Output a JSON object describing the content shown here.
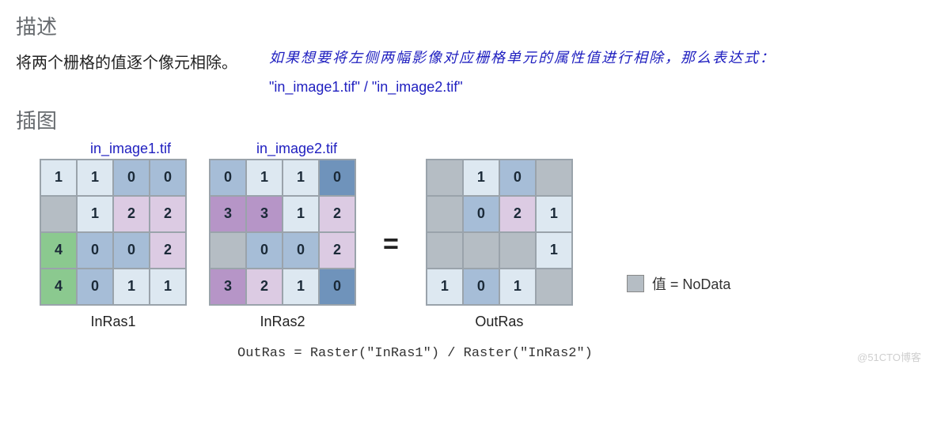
{
  "headings": {
    "describe": "描述",
    "illustration": "插图"
  },
  "description": "将两个栅格的值逐个像元相除。",
  "annotation": {
    "line": "如果想要将左侧两幅影像对应栅格单元的属性值进行相除，那么表达式：",
    "expr": "\"in_image1.tif\" / \"in_image2.tif\""
  },
  "image_labels": {
    "img1": "in_image1.tif",
    "img2": "in_image2.tif"
  },
  "grids": {
    "inras1": {
      "caption": "InRas1",
      "cells": [
        [
          {
            "v": "1",
            "c": "c-lb"
          },
          {
            "v": "1",
            "c": "c-lb"
          },
          {
            "v": "0",
            "c": "c-mb"
          },
          {
            "v": "0",
            "c": "c-mb"
          }
        ],
        [
          {
            "v": "",
            "c": "c-nd"
          },
          {
            "v": "1",
            "c": "c-lb"
          },
          {
            "v": "2",
            "c": "c-lp"
          },
          {
            "v": "2",
            "c": "c-lp"
          }
        ],
        [
          {
            "v": "4",
            "c": "c-gr"
          },
          {
            "v": "0",
            "c": "c-mb"
          },
          {
            "v": "0",
            "c": "c-mb"
          },
          {
            "v": "2",
            "c": "c-lp"
          }
        ],
        [
          {
            "v": "4",
            "c": "c-gr"
          },
          {
            "v": "0",
            "c": "c-mb"
          },
          {
            "v": "1",
            "c": "c-lb"
          },
          {
            "v": "1",
            "c": "c-lb"
          }
        ]
      ]
    },
    "inras2": {
      "caption": "InRas2",
      "cells": [
        [
          {
            "v": "0",
            "c": "c-mb"
          },
          {
            "v": "1",
            "c": "c-lb"
          },
          {
            "v": "1",
            "c": "c-lb"
          },
          {
            "v": "0",
            "c": "c-db"
          }
        ],
        [
          {
            "v": "3",
            "c": "c-mp"
          },
          {
            "v": "3",
            "c": "c-mp"
          },
          {
            "v": "1",
            "c": "c-lb"
          },
          {
            "v": "2",
            "c": "c-lp"
          }
        ],
        [
          {
            "v": "",
            "c": "c-nd"
          },
          {
            "v": "0",
            "c": "c-mb"
          },
          {
            "v": "0",
            "c": "c-mb"
          },
          {
            "v": "2",
            "c": "c-lp"
          }
        ],
        [
          {
            "v": "3",
            "c": "c-mp"
          },
          {
            "v": "2",
            "c": "c-lp"
          },
          {
            "v": "1",
            "c": "c-lb"
          },
          {
            "v": "0",
            "c": "c-db"
          }
        ]
      ]
    },
    "outras": {
      "caption": "OutRas",
      "cells": [
        [
          {
            "v": "",
            "c": "c-nd"
          },
          {
            "v": "1",
            "c": "c-lb"
          },
          {
            "v": "0",
            "c": "c-mb"
          },
          {
            "v": "",
            "c": "c-nd"
          }
        ],
        [
          {
            "v": "",
            "c": "c-nd"
          },
          {
            "v": "0",
            "c": "c-mb"
          },
          {
            "v": "2",
            "c": "c-lp"
          },
          {
            "v": "1",
            "c": "c-lb"
          }
        ],
        [
          {
            "v": "",
            "c": "c-nd"
          },
          {
            "v": "",
            "c": "c-nd"
          },
          {
            "v": "",
            "c": "c-nd"
          },
          {
            "v": "1",
            "c": "c-lb"
          }
        ],
        [
          {
            "v": "1",
            "c": "c-lb"
          },
          {
            "v": "0",
            "c": "c-mb"
          },
          {
            "v": "1",
            "c": "c-lb"
          },
          {
            "v": "",
            "c": "c-nd"
          }
        ]
      ]
    }
  },
  "equals": "=",
  "legend": {
    "text": "值 = NoData"
  },
  "formula": "OutRas = Raster(\"InRas1\") / Raster(\"InRas2\")",
  "watermark": "@51CTO博客"
}
